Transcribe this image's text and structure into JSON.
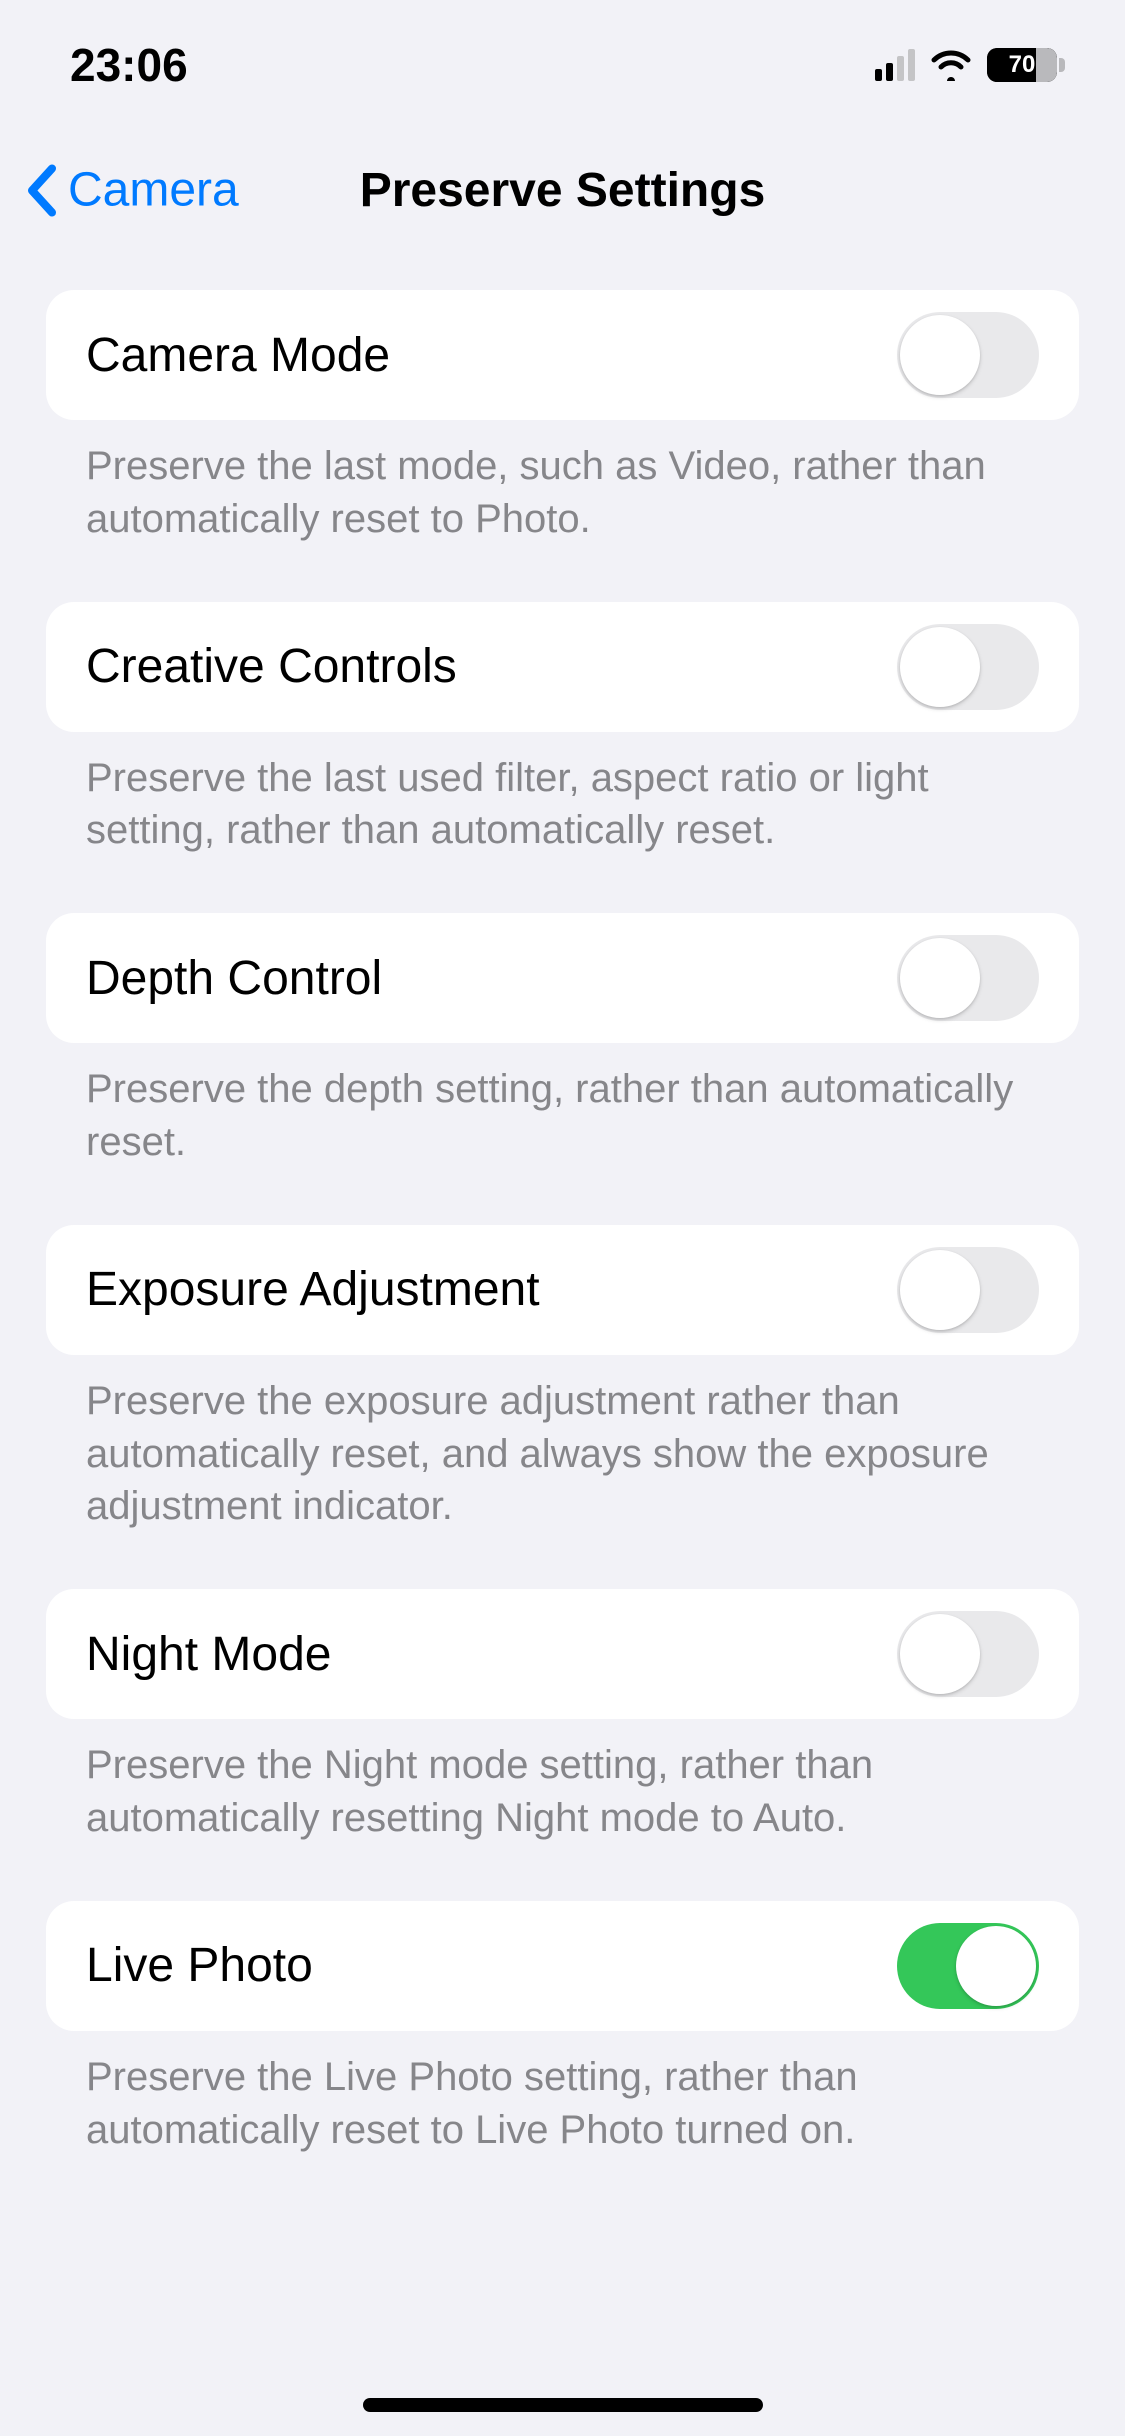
{
  "status": {
    "time": "23:06",
    "battery_pct": "70"
  },
  "nav": {
    "back_label": "Camera",
    "title": "Preserve Settings"
  },
  "settings": [
    {
      "label": "Camera Mode",
      "on": false,
      "footer": "Preserve the last mode, such as Video, rather than automatically reset to Photo."
    },
    {
      "label": "Creative Controls",
      "on": false,
      "footer": "Preserve the last used filter, aspect ratio or light setting, rather than automatically reset."
    },
    {
      "label": "Depth Control",
      "on": false,
      "footer": "Preserve the depth setting, rather than automatically reset."
    },
    {
      "label": "Exposure Adjustment",
      "on": false,
      "footer": "Preserve the exposure adjustment rather than automatically reset, and always show the exposure adjustment indicator."
    },
    {
      "label": "Night Mode",
      "on": false,
      "footer": "Preserve the Night mode setting, rather than automatically resetting Night mode to Auto."
    },
    {
      "label": "Live Photo",
      "on": true,
      "footer": "Preserve the Live Photo setting, rather than automatically reset to Live Photo turned on."
    }
  ]
}
